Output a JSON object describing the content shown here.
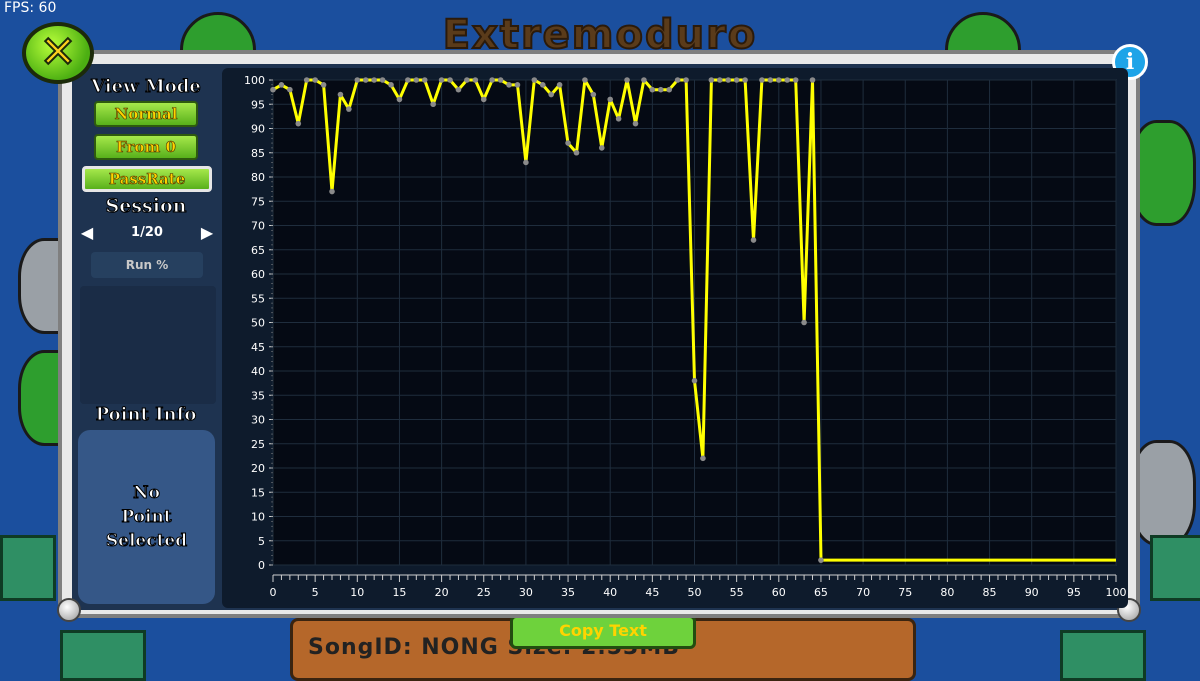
{
  "hud": {
    "fps": "FPS: 60"
  },
  "background": {
    "level_title": "Extremoduro",
    "bottom_bar_text": "SongID: NONG   Size: 2.53MB",
    "copy_text_button": "Copy Text"
  },
  "popup": {
    "view_mode_label": "View Mode",
    "modes": [
      "Normal",
      "From 0",
      "PassRate"
    ],
    "selected_mode": "PassRate",
    "session_label": "Session",
    "session_value": "1/20",
    "run_label": "Run %",
    "point_info_label": "Point Info",
    "point_info_text": "No\nPoint\nSelected"
  },
  "chart_data": {
    "type": "line",
    "xlim": [
      0,
      100
    ],
    "ylim": [
      0,
      100
    ],
    "x_ticks": [
      0,
      5,
      10,
      15,
      20,
      25,
      30,
      35,
      40,
      45,
      50,
      55,
      60,
      65,
      70,
      75,
      80,
      85,
      90,
      95,
      100
    ],
    "y_ticks": [
      0,
      5,
      10,
      15,
      20,
      25,
      30,
      35,
      40,
      45,
      50,
      55,
      60,
      65,
      70,
      75,
      80,
      85,
      90,
      95,
      100
    ],
    "grid": true,
    "line_color": "#ffff00",
    "point_color": "#8a8a8a",
    "series": [
      {
        "points": [
          [
            0,
            98
          ],
          [
            1,
            99
          ],
          [
            2,
            98
          ],
          [
            3,
            91
          ],
          [
            4,
            100
          ],
          [
            5,
            100
          ],
          [
            6,
            99
          ],
          [
            7,
            77
          ],
          [
            8,
            97
          ],
          [
            9,
            94
          ],
          [
            10,
            100
          ],
          [
            11,
            100
          ],
          [
            12,
            100
          ],
          [
            13,
            100
          ],
          [
            14,
            99
          ],
          [
            15,
            96
          ],
          [
            16,
            100
          ],
          [
            17,
            100
          ],
          [
            18,
            100
          ],
          [
            19,
            95
          ],
          [
            20,
            100
          ],
          [
            21,
            100
          ],
          [
            22,
            98
          ],
          [
            23,
            100
          ],
          [
            24,
            100
          ],
          [
            25,
            96
          ],
          [
            26,
            100
          ],
          [
            27,
            100
          ],
          [
            28,
            99
          ],
          [
            29,
            99
          ],
          [
            30,
            83
          ],
          [
            31,
            100
          ],
          [
            32,
            99
          ],
          [
            33,
            97
          ],
          [
            34,
            99
          ],
          [
            35,
            87
          ],
          [
            36,
            85
          ],
          [
            37,
            100
          ],
          [
            38,
            97
          ],
          [
            39,
            86
          ],
          [
            40,
            96
          ],
          [
            41,
            92
          ],
          [
            42,
            100
          ],
          [
            43,
            91
          ],
          [
            44,
            100
          ],
          [
            45,
            98
          ],
          [
            46,
            98
          ],
          [
            47,
            98
          ],
          [
            48,
            100
          ],
          [
            49,
            100
          ],
          [
            50,
            38
          ],
          [
            51,
            22
          ],
          [
            52,
            100
          ],
          [
            53,
            100
          ],
          [
            54,
            100
          ],
          [
            55,
            100
          ],
          [
            56,
            100
          ],
          [
            57,
            67
          ],
          [
            58,
            100
          ],
          [
            59,
            100
          ],
          [
            60,
            100
          ],
          [
            61,
            100
          ],
          [
            62,
            100
          ],
          [
            63,
            50
          ],
          [
            64,
            100
          ],
          [
            65,
            1
          ],
          [
            66,
            1
          ],
          [
            67,
            1
          ],
          [
            68,
            1
          ],
          [
            69,
            1
          ],
          [
            70,
            1
          ],
          [
            75,
            1
          ],
          [
            80,
            1
          ],
          [
            85,
            1
          ],
          [
            90,
            1
          ],
          [
            95,
            1
          ],
          [
            100,
            1
          ]
        ]
      }
    ]
  },
  "colors": {
    "popup_border": "#e9e9e9",
    "panel_bg": "#1e3350",
    "chart_bg": "#050a14",
    "button_green": "#58b01b",
    "button_text": "#ffd400"
  }
}
